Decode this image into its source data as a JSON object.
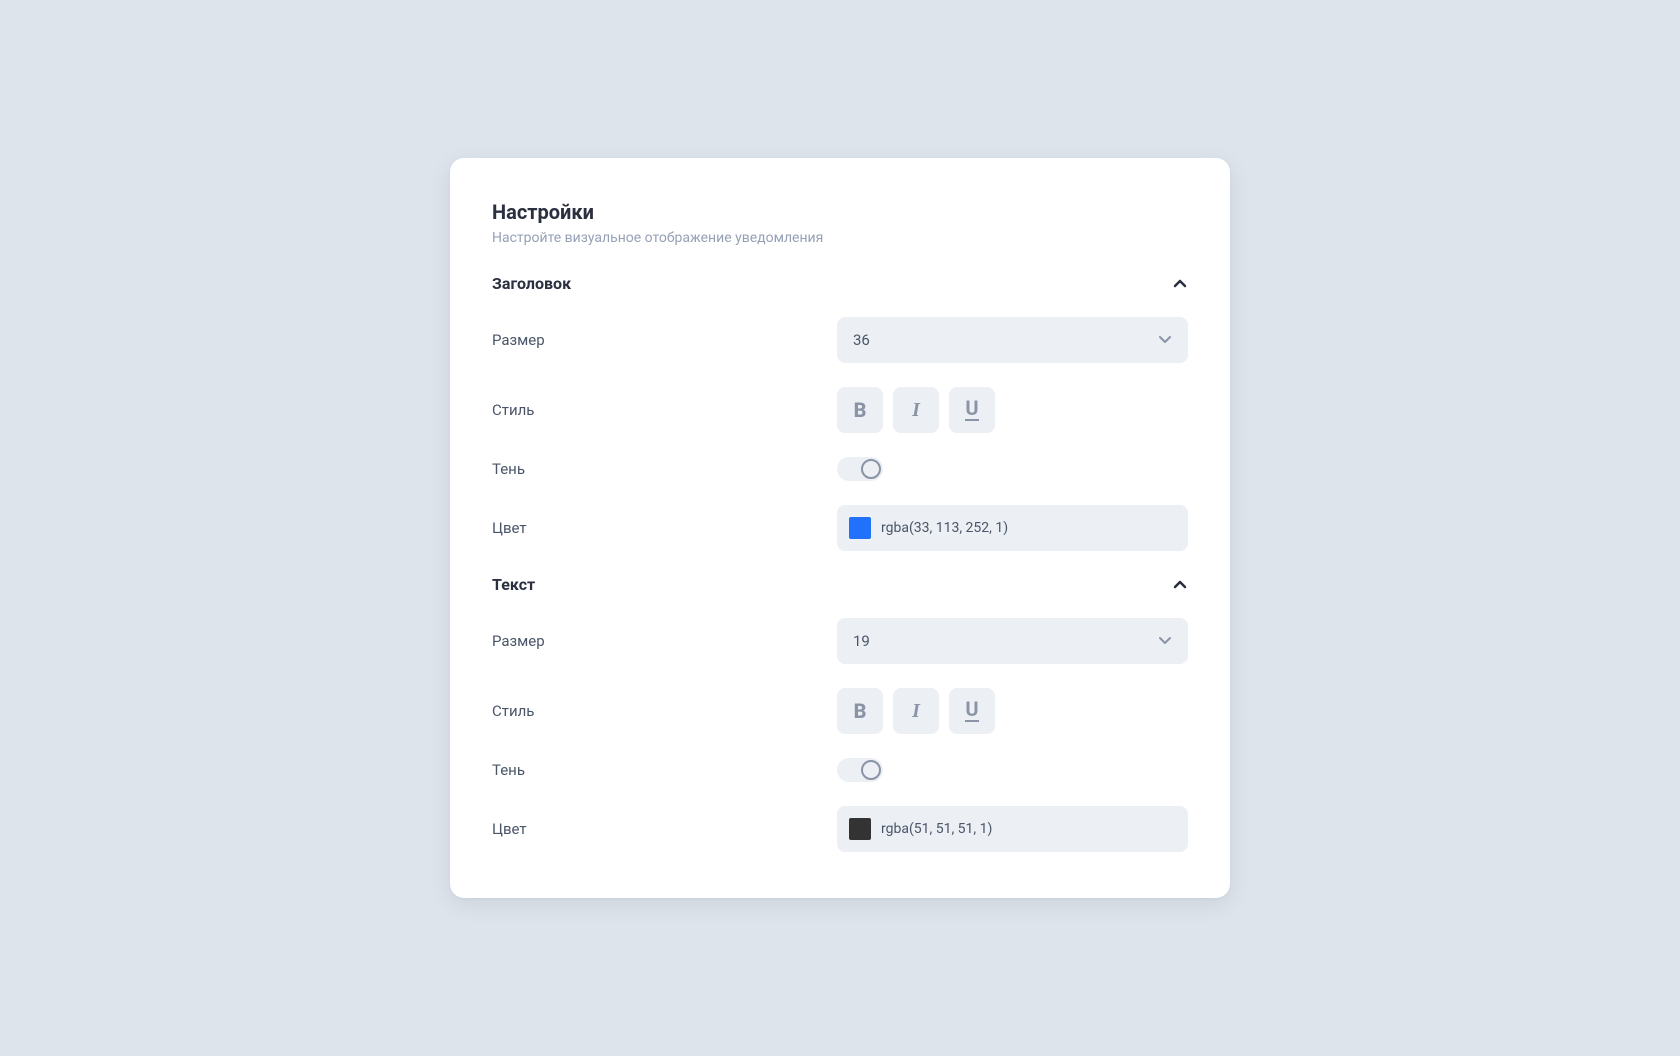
{
  "panel": {
    "title": "Настройки",
    "subtitle": "Настройте визуальное отображение уведомления"
  },
  "sections": {
    "header": {
      "title": "Заголовок",
      "size_label": "Размер",
      "size_value": "36",
      "style_label": "Стиль",
      "style_bold": "B",
      "style_italic": "I",
      "style_underline": "U",
      "shadow_label": "Тень",
      "shadow_on": false,
      "color_label": "Цвет",
      "color_value": "rgba(33, 113, 252, 1)",
      "color_hex": "#2171FC"
    },
    "text": {
      "title": "Текст",
      "size_label": "Размер",
      "size_value": "19",
      "style_label": "Стиль",
      "style_bold": "B",
      "style_italic": "I",
      "style_underline": "U",
      "shadow_label": "Тень",
      "shadow_on": false,
      "color_label": "Цвет",
      "color_value": "rgba(51, 51, 51, 1)",
      "color_hex": "#333333"
    }
  }
}
